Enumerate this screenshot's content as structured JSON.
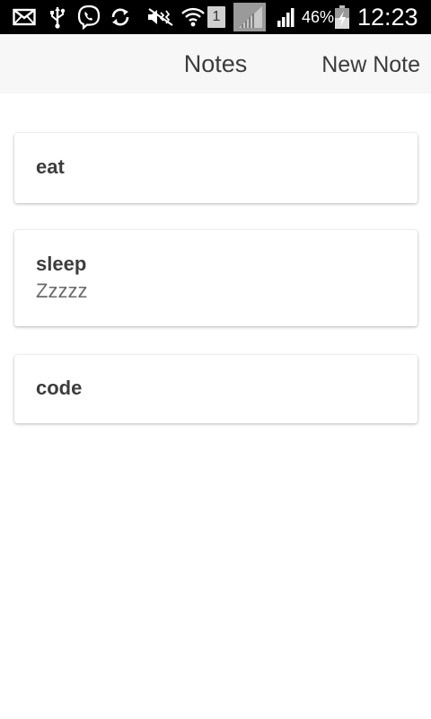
{
  "status_bar": {
    "battery_percent": "46%",
    "time": "12:23",
    "sim_slot": "1",
    "icons": [
      "mail-icon",
      "usb-icon",
      "viber-icon",
      "sync-icon",
      "mute-icon",
      "wifi-icon",
      "sim-badge",
      "signal-image-icon",
      "signal-icon",
      "battery-charging-icon"
    ]
  },
  "nav": {
    "title": "Notes",
    "new_note_label": "New Note"
  },
  "notes": [
    {
      "title": "eat",
      "body": ""
    },
    {
      "title": "sleep",
      "body": "Zzzzz"
    },
    {
      "title": "code",
      "body": ""
    }
  ]
}
